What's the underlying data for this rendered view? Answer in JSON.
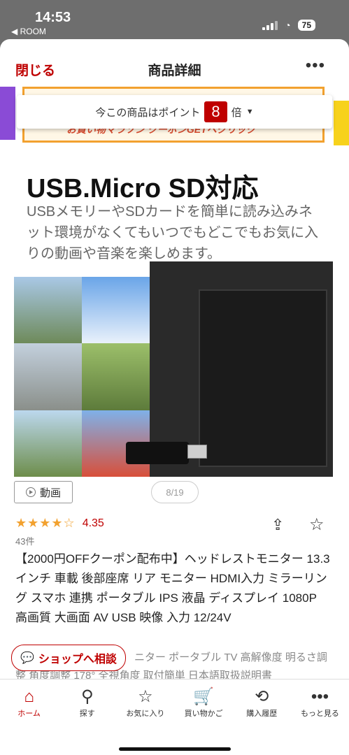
{
  "status": {
    "time": "14:53",
    "back_label": "◀ ROOM",
    "battery": "75"
  },
  "header": {
    "close_label": "閉じる",
    "title": "商品詳細",
    "more_icon": "•••"
  },
  "banner": {
    "text": "お買い物マラソン クーポンGETへクリック"
  },
  "points": {
    "prefix": "今この商品はポイント",
    "multiplier": "8",
    "suffix": "倍"
  },
  "hero": {
    "title": "USB.Micro SD対応",
    "subtitle": "USBメモリーやSDカードを簡単に読み込みネット環境がなくてもいつでもどこでもお気に入りの動画や音楽を楽しめます。"
  },
  "media": {
    "video_label": "動画",
    "pager": "8/19"
  },
  "rating": {
    "stars": "★★★★☆",
    "score": "4.35",
    "count": "43件"
  },
  "product": {
    "name": "【2000円OFFクーポン配布中】ヘッドレストモニター 13.3インチ 車載 後部座席 リア モニター HDMI入力 ミラーリング スマホ 連携 ポータブル IPS 液晶 ディスプレイ 1080P 高画質 大画面 AV USB 映像 入力 12/24V",
    "desc_more": "ニター ポータブル TV 高解像度 明るさ調整 角度調整 178° 全視角度 取付簡単 日本語取扱説明書"
  },
  "shop_chip": {
    "label": "ショップへ相談"
  },
  "nav": [
    {
      "label": "ホーム",
      "icon": "⌂"
    },
    {
      "label": "探す",
      "icon": "⚲"
    },
    {
      "label": "お気に入り",
      "icon": "☆"
    },
    {
      "label": "買い物かご",
      "icon": "🛒"
    },
    {
      "label": "購入履歴",
      "icon": "⟲"
    },
    {
      "label": "もっと見る",
      "icon": "•••"
    }
  ]
}
